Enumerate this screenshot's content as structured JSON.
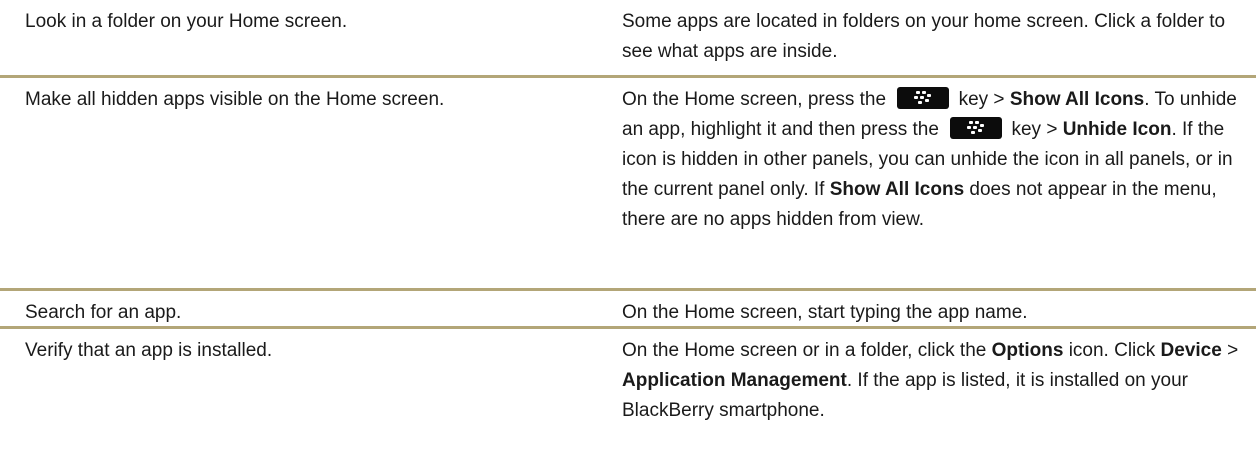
{
  "rows": [
    {
      "task": "Look in a folder on your Home screen.",
      "detail": {
        "text": "Some apps are located in folders on your home screen. Click a folder to see what apps are inside."
      }
    },
    {
      "task": "Make all hidden apps visible on the Home screen.",
      "detail": {
        "t1": "On the Home screen, press the",
        "t2": "key >",
        "b1": "Show All Icons",
        "t3": ". To unhide an app, highlight it and then press the",
        "t4": "key >",
        "b2": "Unhide Icon",
        "t5": ". If the icon is hidden in other panels, you can unhide the icon in all panels, or in the current panel only. If",
        "b3": "Show All Icons",
        "t6": "does not appear in the menu, there are no apps hidden from view."
      }
    },
    {
      "task": "Search for an app.",
      "detail": {
        "text": "On the Home screen, start typing the app name."
      }
    },
    {
      "task": "Verify that an app is installed.",
      "detail": {
        "t1": "On the Home screen or in a folder, click the",
        "b1": "Options",
        "t2": "icon. Click",
        "b2": "Device",
        "t3": ">",
        "b3": "Application Management",
        "t4": ". If the app is listed, it is installed on your BlackBerry smartphone."
      }
    }
  ],
  "icons": {
    "menu_key": "blackberry-menu-key-icon"
  },
  "colors": {
    "rule": "#b3a678",
    "key_background": "#0c0c0c",
    "text": "#1a1a1a"
  }
}
